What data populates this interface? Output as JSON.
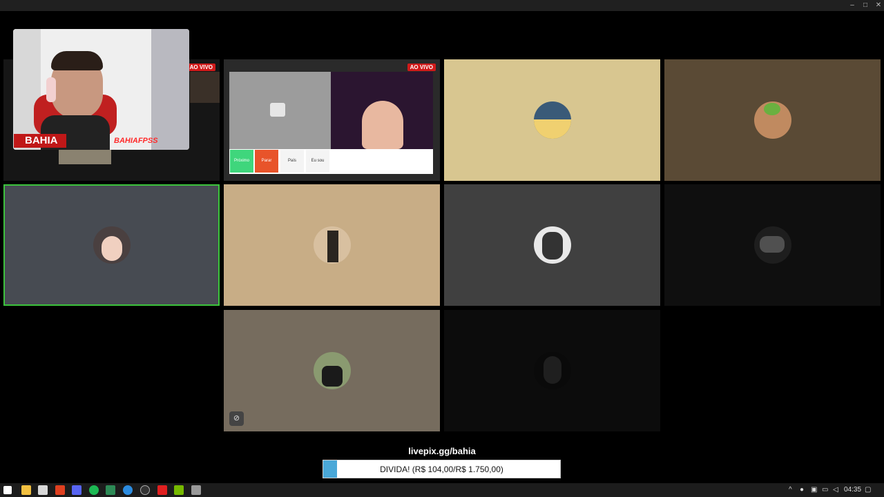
{
  "window": {
    "minimize_icon": "minimize-icon",
    "maximize_icon": "maximize-icon",
    "close_icon": "close-icon"
  },
  "stream": {
    "live_badge": "AO VIVO",
    "streamer_tag": "BAHIA",
    "streamer_tag2": "BAHIAFPSS",
    "screen_buttons": [
      "Próximo",
      "Parar",
      "País",
      "Eu sou"
    ]
  },
  "tiles_colors": {
    "active_border": "#3cc43c",
    "t3": "#d8c690",
    "t4": "#5a4a35",
    "t5": "#474b52",
    "t6": "#c8ad86",
    "t7": "#404040",
    "t8": "#0f0f0f",
    "t9": "#766c5e",
    "t10": "#0c0c0c"
  },
  "donation": {
    "url": "livepix.gg/bahia",
    "goal_text": "DIVIDA! (R$ 104,00/R$ 1.750,00)",
    "progress_fraction": 0.0594
  },
  "taskbar": {
    "time": "04:35",
    "icons": [
      "windows-start-icon",
      "file-explorer-icon",
      "store-icon",
      "brave-icon",
      "discord-icon",
      "spotify-icon",
      "edge-icon",
      "obs-icon",
      "youtube-icon",
      "nvidia-icon",
      "app-icon"
    ]
  }
}
